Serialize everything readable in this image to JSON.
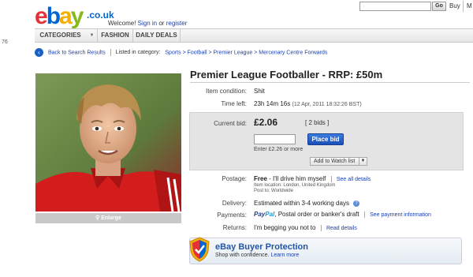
{
  "margin_number": "76",
  "header": {
    "logo": {
      "e": "e",
      "b": "b",
      "a": "a",
      "y": "y",
      "domain": ".co.uk"
    },
    "welcome_prefix": "Welcome!",
    "sign_in": "Sign in",
    "or": "or",
    "register": "register",
    "search_button": "Go",
    "buy": "Buy",
    "truncated_item": "M"
  },
  "nav": {
    "categories": "CATEGORIES",
    "fashion": "FASHION",
    "daily_deals": "DAILY DEALS"
  },
  "breadcrumb": {
    "back": "Back to Search Results",
    "listed_in": "Listed in category:",
    "path": "Sports > Football > Premier League > Mercenary Centre Forwards"
  },
  "photo": {
    "enlarge": "Enlarge"
  },
  "listing": {
    "title": "Premier League Footballer - RRP: £50m",
    "condition_label": "Item condition:",
    "condition_value": "Shit",
    "time_label": "Time left:",
    "time_value": "23h 14m 16s",
    "time_detail": "(12 Apr, 2011  18:32:26 BST)",
    "bid_label": "Current bid:",
    "bid_amount": "£2.06",
    "bids_link": "[ 2 bids ]",
    "bid_input_value": "",
    "place_bid": "Place bid",
    "enter_hint": "Enter £2.26 or more",
    "watch_list": "Add to Watch list",
    "postage_label": "Postage:",
    "postage_free": "Free",
    "postage_note": "- I'll drive him myself",
    "postage_see_all": "See all details",
    "item_location": "Item location:   London, United Kingdom",
    "post_to": "Post to:  Worldwide",
    "delivery_label": "Delivery:",
    "delivery_value": "Estimated within 3-4 working days",
    "payments_label": "Payments:",
    "paypal_pay": "Pay",
    "paypal_pal": "Pal",
    "payments_value": ", Postal order or banker's draft",
    "payments_link": "See payment information",
    "returns_label": "Returns:",
    "returns_value": "I'm begging you not to",
    "returns_link": "Read details"
  },
  "protection": {
    "title": "eBay Buyer Protection",
    "subtitle": "Shop with confidence.",
    "learn_more": "Learn more"
  },
  "colors": {
    "ebay_red": "#e53238",
    "ebay_blue": "#0064d2",
    "ebay_yellow": "#f5af02",
    "ebay_green": "#86b817",
    "link": "#1a3fb0",
    "place_bid": "#1b4fb5"
  }
}
